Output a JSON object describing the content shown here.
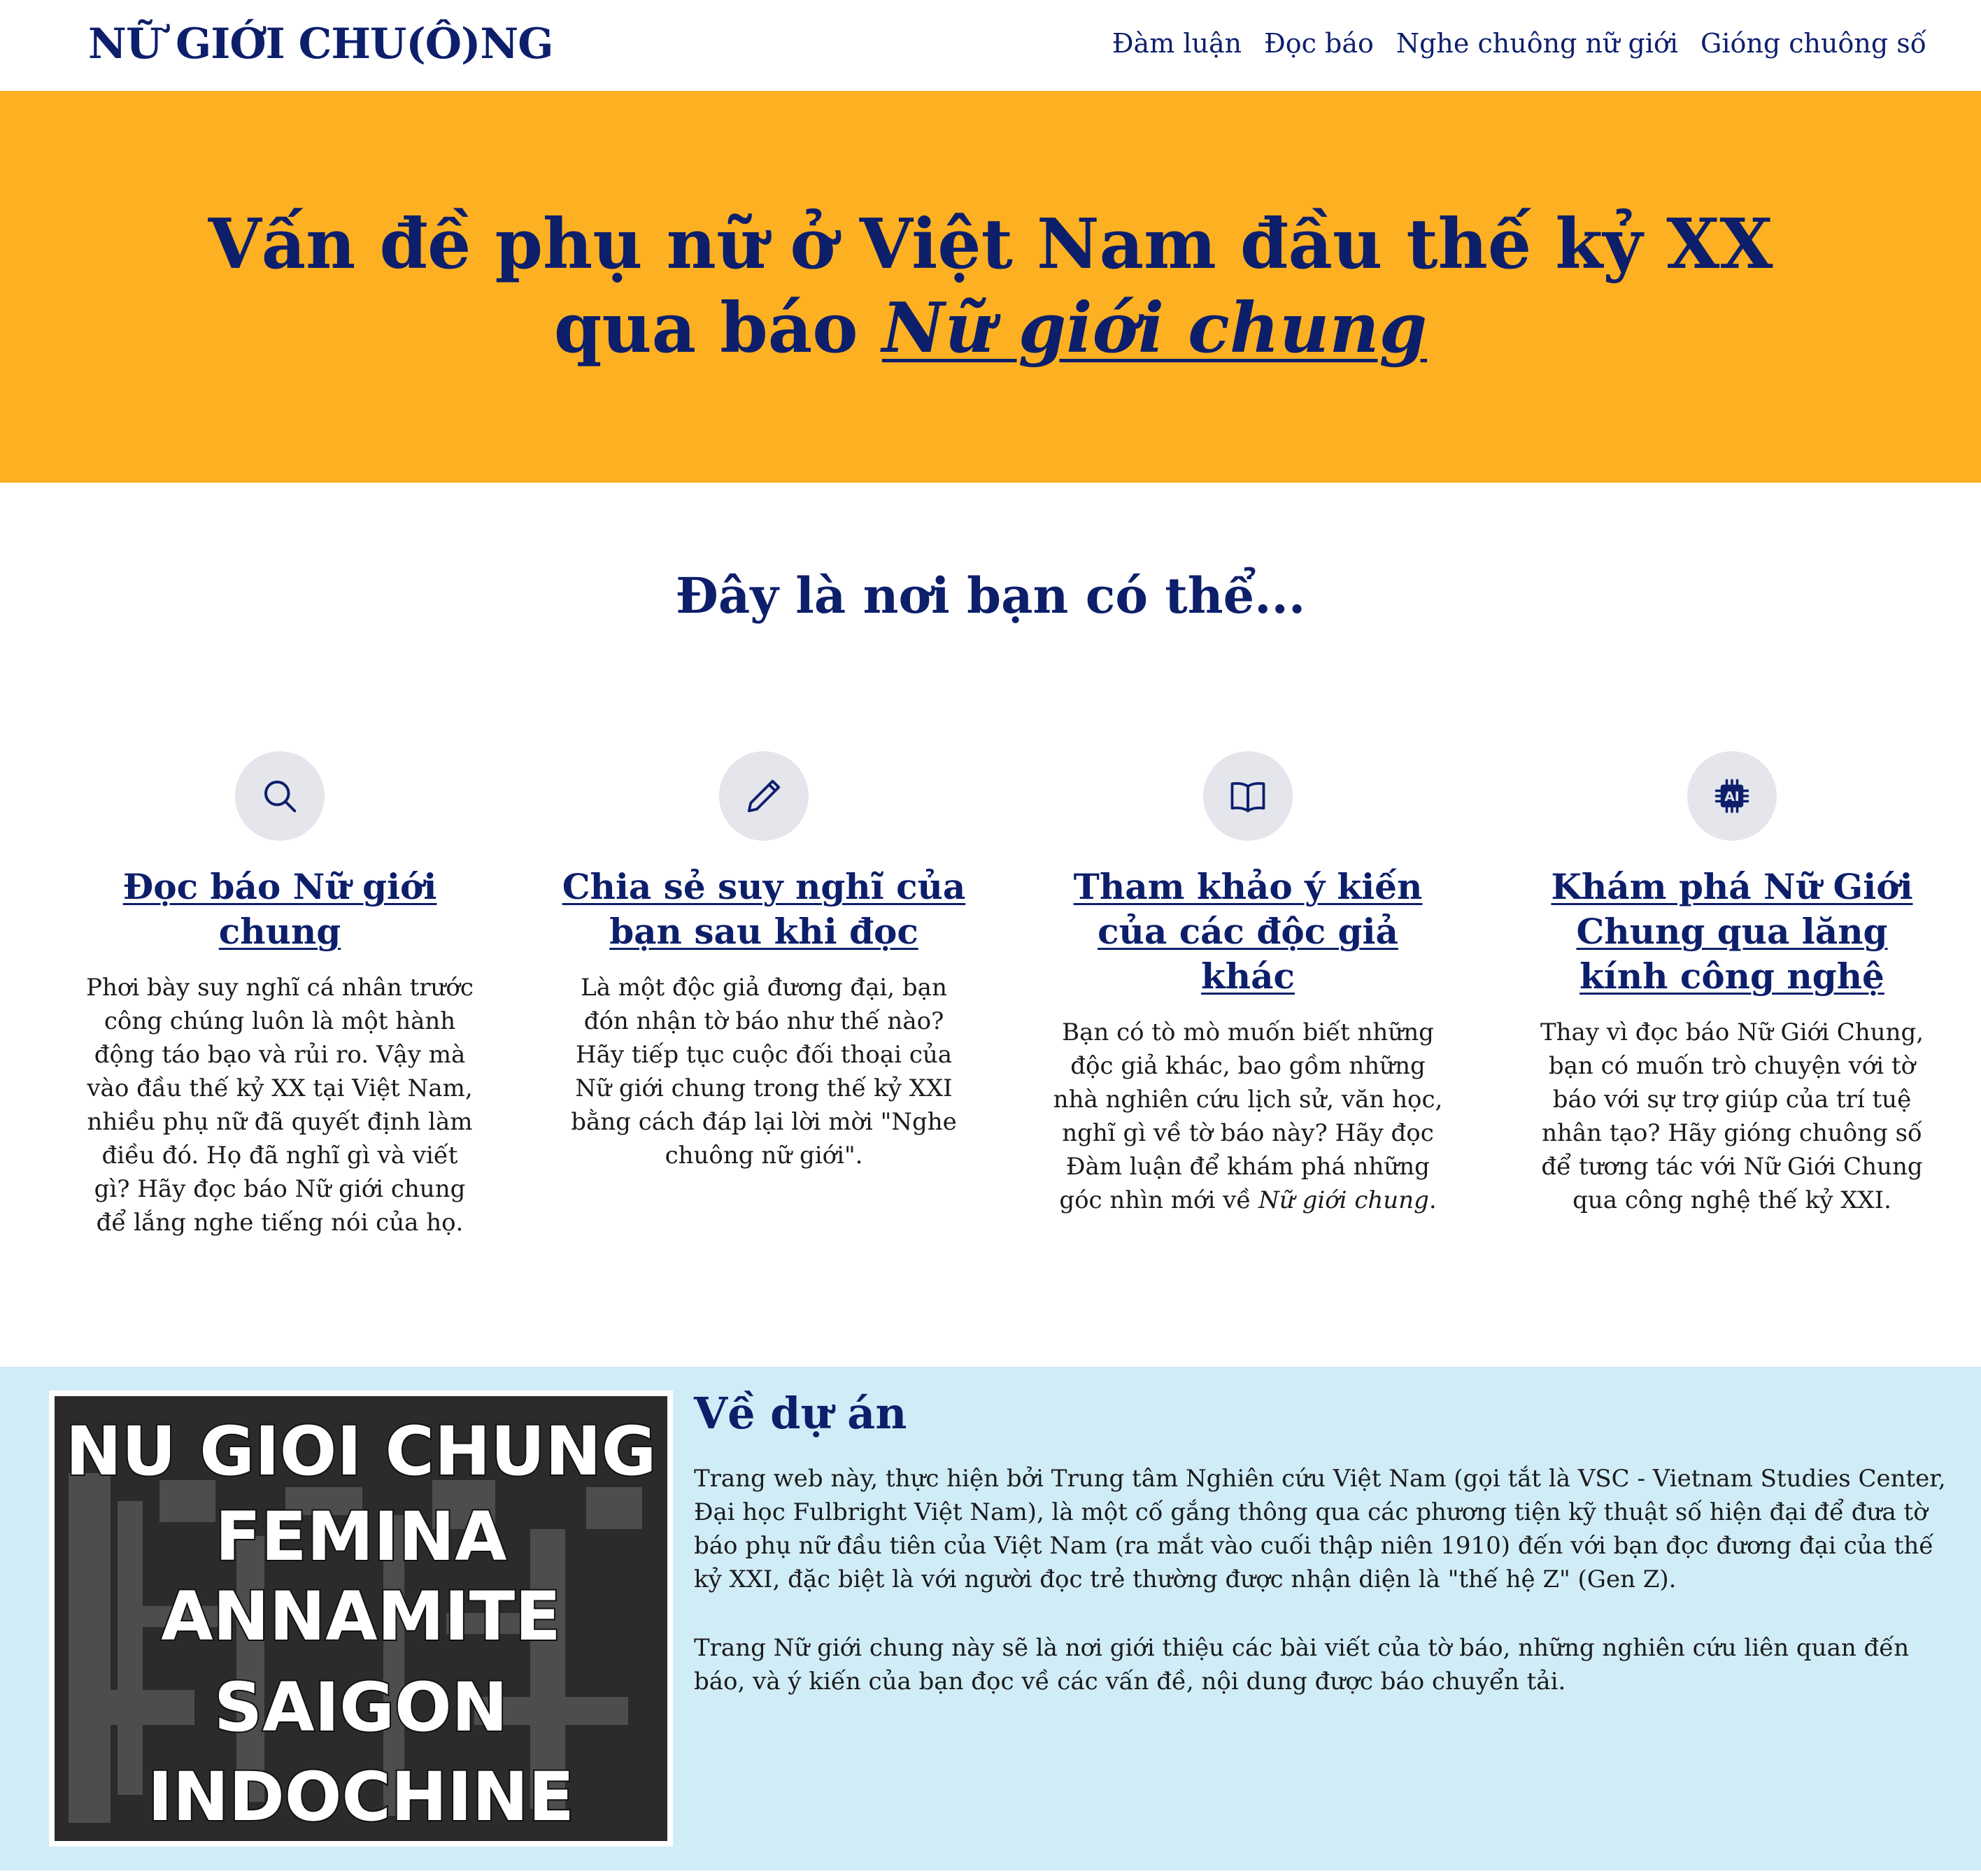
{
  "navbar": {
    "brand": "NỮ GIỚI CHU(Ô)NG",
    "links": [
      "Đàm luận",
      "Đọc báo",
      "Nghe chuông nữ giới",
      "Gióng chuông số"
    ]
  },
  "hero": {
    "line1": "Vấn đề phụ nữ ở Việt Nam đầu thế kỷ XX",
    "line2_prefix": "qua báo",
    "line2_emphasis": "Nữ giới chung"
  },
  "features_section": {
    "title": "Đây là nơi bạn có thể...",
    "items": [
      {
        "icon": "search-icon",
        "title": "Đọc báo Nữ giới chung",
        "description": "Phơi bày suy nghĩ cá nhân trước công chúng luôn là một hành động táo bạo và rủi ro. Vậy mà vào đầu thế kỷ XX tại Việt Nam, nhiều phụ nữ đã quyết định làm điều đó. Họ đã nghĩ gì và viết gì? Hãy đọc báo Nữ giới chung để lắng nghe tiếng nói của họ."
      },
      {
        "icon": "pencil-icon",
        "title": "Chia sẻ suy nghĩ của bạn sau khi đọc",
        "description": "Là một độc giả đương đại, bạn đón nhận tờ báo như thế nào? Hãy tiếp tục cuộc đối thoại của Nữ giới chung trong thế kỷ XXI bằng cách đáp lại lời mời \"Nghe chuông nữ giới\"."
      },
      {
        "icon": "book-icon",
        "title": "Tham khảo ý kiến của các độc giả khác",
        "description": "Bạn có tò mò muốn biết những độc giả khác, bao gồm những nhà nghiên cứu lịch sử, văn học, nghĩ gì về tờ báo này? Hãy đọc Đàm luận để khám phá những góc nhìn mới về",
        "description_em": "Nữ giới chung",
        "description_end": "."
      },
      {
        "icon": "ai-chip-icon",
        "icon_label": "AI",
        "title": "Khám phá Nữ Giới Chung qua lăng kính công nghệ",
        "description": "Thay vì đọc báo Nữ Giới Chung, bạn có muốn trò chuyện với tờ báo với sự trợ giúp của trí tuệ nhân tạo? Hãy gióng chuông số để tương tác với Nữ Giới Chung qua công nghệ thế kỷ XXI."
      }
    ]
  },
  "about": {
    "heading": "Về dự án",
    "paragraphs": [
      "Trang web này, thực hiện bởi Trung tâm Nghiên cứu Việt Nam (gọi tắt là VSC - Vietnam Studies Center, Đại học Fulbright Việt Nam), là một cố gắng thông qua các phương tiện kỹ thuật số hiện đại để đưa tờ báo phụ nữ đầu tiên của Việt Nam (ra mắt vào cuối thập niên 1910) đến với bạn đọc đương đại của thế kỷ XXI, đặc biệt là với người đọc trẻ thường được nhận diện là \"thế hệ Z\" (Gen Z).",
      "Trang Nữ giới chung này sẽ là nơi giới thiệu các bài viết của tờ báo, những nghiên cứu liên quan đến báo, và ý kiến của bạn đọc về các vấn đề, nội dung được báo chuyển tải."
    ],
    "image_lines": [
      "NU GIOI CHUNG",
      "FEMINA",
      "ANNAMITE",
      "SAIGON",
      "INDOCHINE"
    ]
  },
  "colors": {
    "navy": "#0d1f6b",
    "hero_bg": "#fdb022",
    "about_bg": "#d0ecf7",
    "icon_circle": "#e4e6ec"
  }
}
